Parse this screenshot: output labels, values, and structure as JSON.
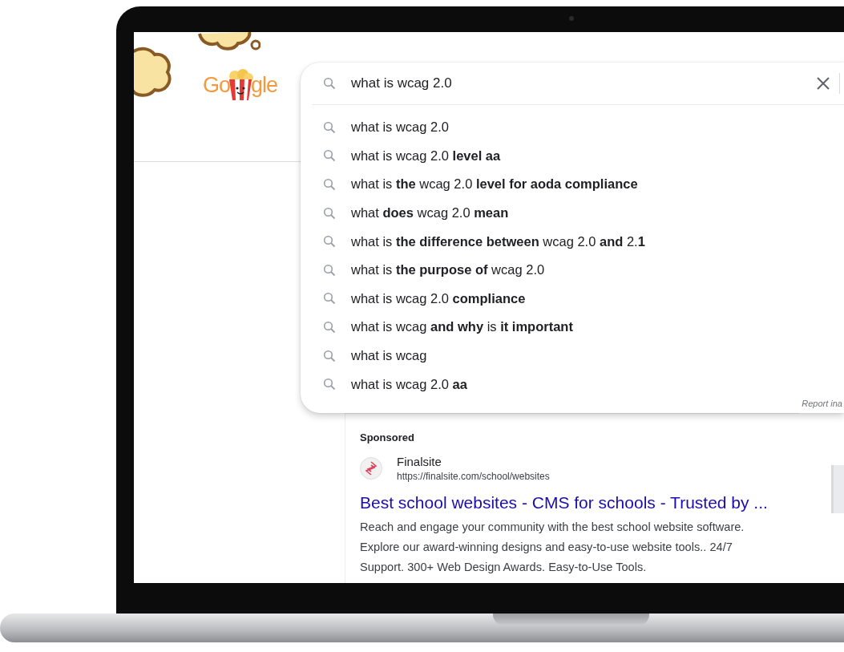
{
  "logo": {
    "left": "Go",
    "right": "gle"
  },
  "search": {
    "value": "what is wcag 2.0"
  },
  "suggestions": [
    {
      "text": "what is wcag 2.0"
    },
    {
      "text": "what is wcag 2.0 **level aa**"
    },
    {
      "text": "what is **the** wcag 2.0 **level for aoda compliance**"
    },
    {
      "text": "what **does** wcag 2.0 **mean**"
    },
    {
      "text": "what is **the difference between** wcag 2.0 **and** 2.**1**"
    },
    {
      "text": "what is **the purpose of** wcag 2.0"
    },
    {
      "text": "what is wcag 2.0 **compliance**"
    },
    {
      "text": "what is wcag **and why** is **it important**"
    },
    {
      "text": "what is wcag"
    },
    {
      "text": "what is wcag 2.0 **aa**"
    }
  ],
  "report_link": "Report ina",
  "ad": {
    "label": "Sponsored",
    "site_name": "Finalsite",
    "url": "https://finalsite.com/school/websites",
    "title": "Best school websites - CMS for schools - Trusted by ...",
    "description": "Reach and engage your community with the best school website software. Explore our award-winning designs and easy-to-use website tools.. 24/7 Support. 300+ Web Design Awards. Easy-to-Use Tools."
  }
}
